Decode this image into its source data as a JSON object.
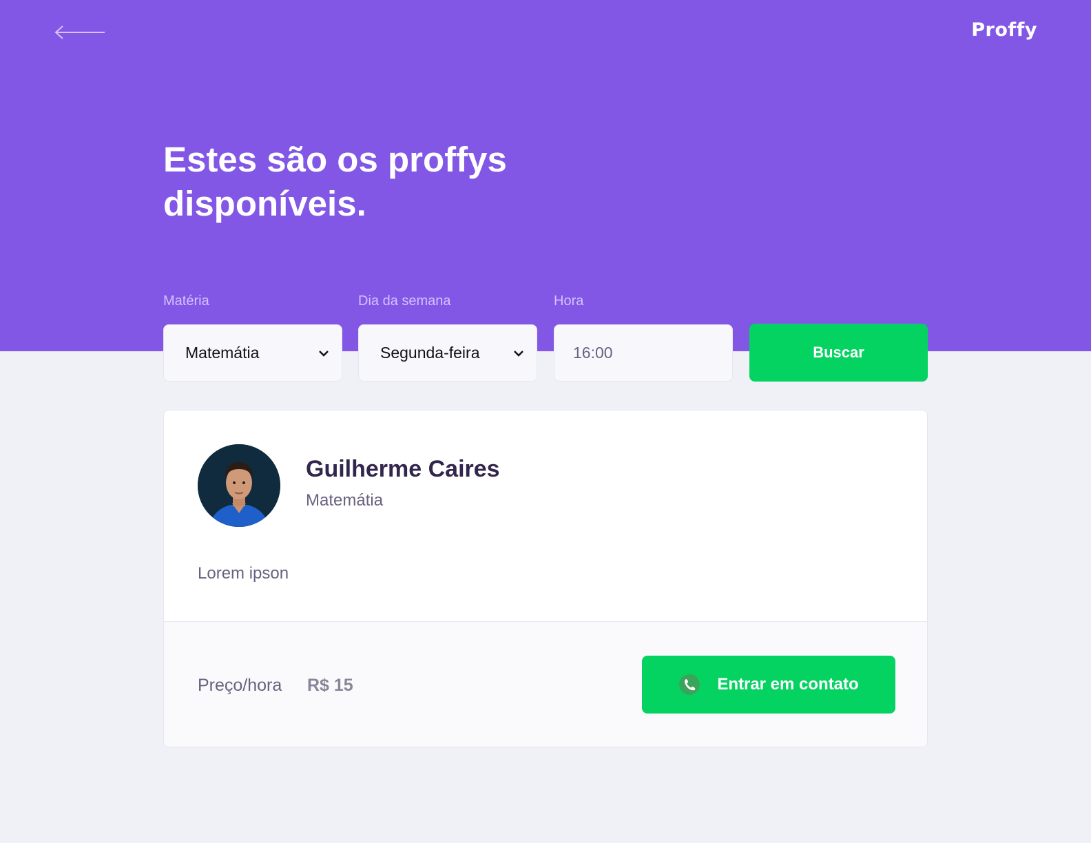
{
  "app": {
    "logo": "Proffy",
    "page_title": "Estes são os proffys disponíveis."
  },
  "filters": {
    "subject": {
      "label": "Matéria",
      "value": "Matemátia"
    },
    "weekday": {
      "label": "Dia da semana",
      "value": "Segunda-feira"
    },
    "time": {
      "label": "Hora",
      "value": "16:00"
    },
    "search_button": "Buscar"
  },
  "teacher": {
    "name": "Guilherme Caires",
    "subject": "Matemátia",
    "bio": "Lorem ipson",
    "price_label": "Preço/hora",
    "price_value": "R$ 15",
    "contact_button": "Entrar em contato"
  },
  "icons": {
    "back": "arrow-left-icon",
    "select": "chevron-down-icon",
    "contact": "whatsapp-icon"
  },
  "colors": {
    "primary": "#8257e5",
    "secondary": "#04d361",
    "background": "#f0f0f7",
    "title": "#32264d",
    "text": "#6a6180"
  }
}
